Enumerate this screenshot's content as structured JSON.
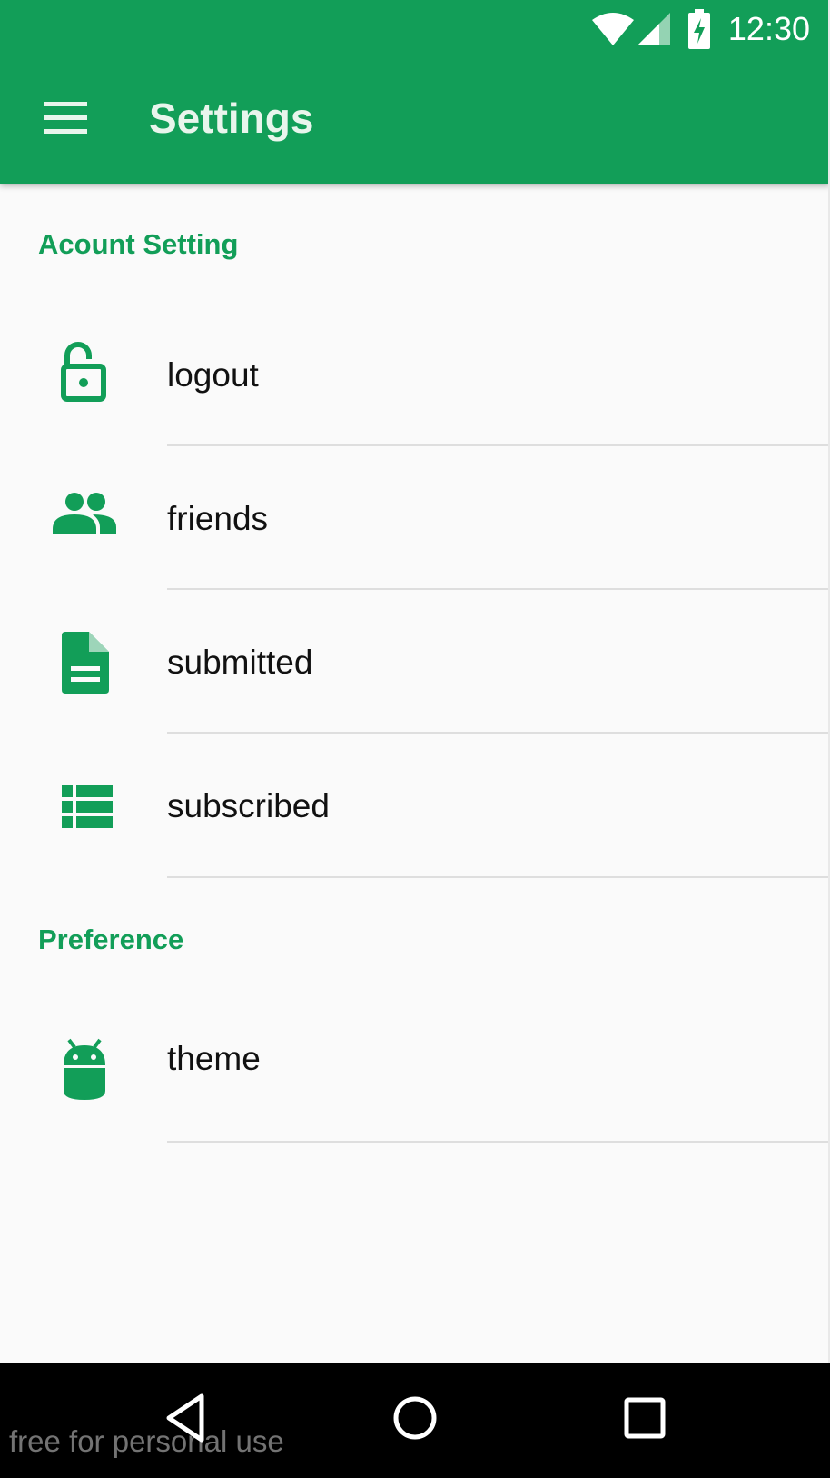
{
  "status_bar": {
    "time": "12:30",
    "icons": [
      "wifi-icon",
      "signal-icon",
      "battery-charging-icon"
    ]
  },
  "toolbar": {
    "title": "Settings",
    "menu_icon": "menu-icon"
  },
  "sections": [
    {
      "header": "Acount Setting",
      "items": [
        {
          "label": "logout",
          "icon": "lock-open-icon"
        },
        {
          "label": "friends",
          "icon": "people-icon"
        },
        {
          "label": "submitted",
          "icon": "document-icon"
        },
        {
          "label": "subscribed",
          "icon": "list-icon"
        }
      ]
    },
    {
      "header": "Preference",
      "items": [
        {
          "label": "theme",
          "icon": "android-icon"
        }
      ]
    }
  ],
  "nav_bar": {
    "buttons": [
      "back-icon",
      "home-icon",
      "recents-icon"
    ]
  },
  "watermark": "free for personal use",
  "colors": {
    "primary": "#129e58",
    "background": "#fafafa",
    "text": "#111111",
    "divider": "#dedede"
  }
}
